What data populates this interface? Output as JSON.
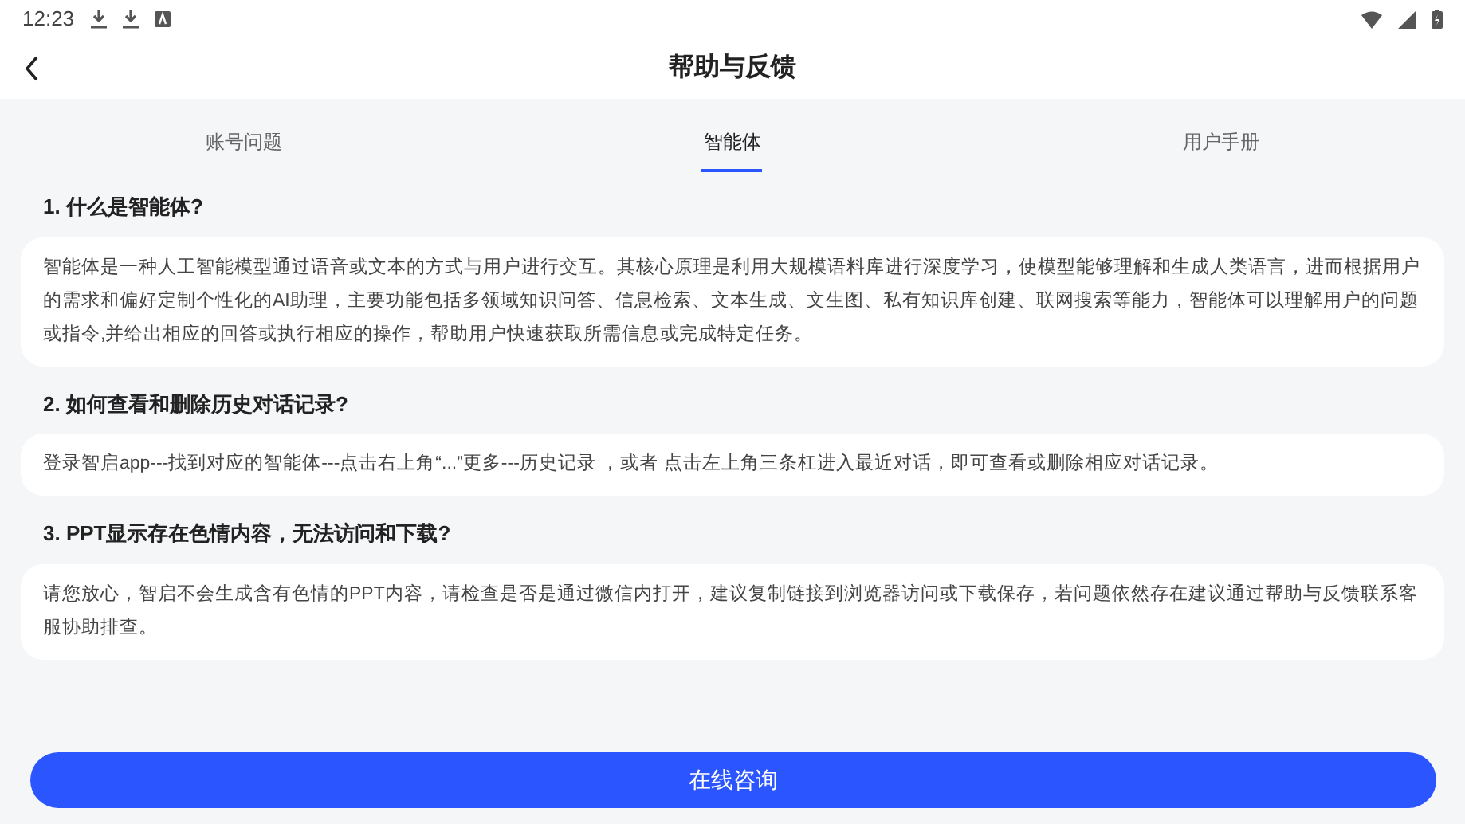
{
  "status_bar": {
    "time": "12:23"
  },
  "header": {
    "title": "帮助与反馈"
  },
  "tabs": [
    {
      "label": "账号问题",
      "selected": false
    },
    {
      "label": "智能体",
      "selected": true
    },
    {
      "label": "用户手册",
      "selected": false
    }
  ],
  "faq": [
    {
      "question": "1. 什么是智能体?",
      "answer": "智能体是一种人工智能模型通过语音或文本的方式与用户进行交互。其核心原理是利用大规模语料库进行深度学习，使模型能够理解和生成人类语言，进而根据用户的需求和偏好定制个性化的AI助理，主要功能包括多领域知识问答、信息检索、文本生成、文生图、私有知识库创建、联网搜索等能力，智能体可以理解用户的问题或指令,并给出相应的回答或执行相应的操作，帮助用户快速获取所需信息或完成特定任务。"
    },
    {
      "question": "2. 如何查看和删除历史对话记录?",
      "answer": "登录智启app---找到对应的智能体---点击右上角“...”更多---历史记录 ，或者 点击左上角三条杠进入最近对话，即可查看或删除相应对话记录。"
    },
    {
      "question": "3. PPT显示存在色情内容，无法访问和下载?",
      "answer": "请您放心，智启不会生成含有色情的PPT内容，请检查是否是通过微信内打开，建议复制链接到浏览器访问或下载保存，若问题依然存在建议通过帮助与反馈联系客服协助排查。"
    }
  ],
  "consult_button": {
    "label": "在线咨询"
  }
}
